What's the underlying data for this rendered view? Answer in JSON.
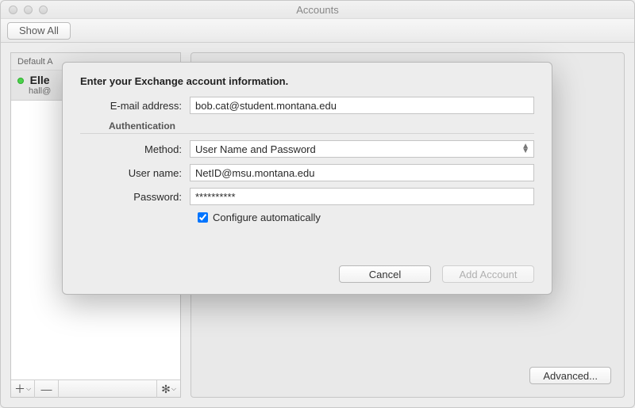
{
  "window": {
    "title": "Accounts",
    "show_all_label": "Show All"
  },
  "sidebar": {
    "header": "Default A",
    "account": {
      "name": "Elle",
      "sub": "hall@"
    },
    "footer": {
      "add_glyph": "＋",
      "add_caret": "⌵",
      "remove_glyph": "—",
      "gear_glyph": "✻",
      "gear_caret": "⌵"
    }
  },
  "main": {
    "advanced_label": "Advanced..."
  },
  "dialog": {
    "title": "Enter your Exchange account information.",
    "email_label": "E-mail address:",
    "email_value": "bob.cat@student.montana.edu",
    "auth_section": "Authentication",
    "method_label": "Method:",
    "method_value": "User Name and Password",
    "user_label": "User name:",
    "user_value": "NetID@msu.montana.edu",
    "password_label": "Password:",
    "password_value": "**********",
    "auto_label": "Configure automatically",
    "auto_checked": true,
    "cancel_label": "Cancel",
    "add_label": "Add Account"
  }
}
